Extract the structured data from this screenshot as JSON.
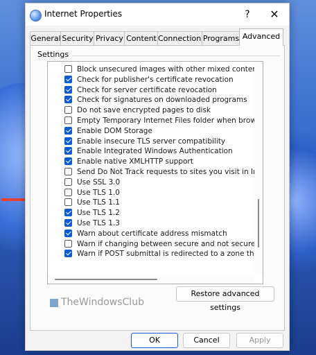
{
  "window": {
    "title": "Internet Properties",
    "help_glyph": "?",
    "close_glyph": "✕"
  },
  "tabs": [
    {
      "label": "General"
    },
    {
      "label": "Security"
    },
    {
      "label": "Privacy"
    },
    {
      "label": "Content"
    },
    {
      "label": "Connections"
    },
    {
      "label": "Programs"
    },
    {
      "label": "Advanced"
    }
  ],
  "settings": {
    "group_label": "Settings",
    "items": [
      {
        "label": "Block unsecured images with other mixed content",
        "checked": false
      },
      {
        "label": "Check for publisher's certificate revocation",
        "checked": true
      },
      {
        "label": "Check for server certificate revocation",
        "checked": true
      },
      {
        "label": "Check for signatures on downloaded programs",
        "checked": true
      },
      {
        "label": "Do not save encrypted pages to disk",
        "checked": false
      },
      {
        "label": "Empty Temporary Internet Files folder when browser is clo",
        "checked": false
      },
      {
        "label": "Enable DOM Storage",
        "checked": true
      },
      {
        "label": "Enable insecure TLS server compatibility",
        "checked": true
      },
      {
        "label": "Enable Integrated Windows Authentication",
        "checked": true
      },
      {
        "label": "Enable native XMLHTTP support",
        "checked": true
      },
      {
        "label": "Send Do Not Track requests to sites you visit in Internet E",
        "checked": false
      },
      {
        "label": "Use SSL 3.0",
        "checked": false
      },
      {
        "label": "Use TLS 1.0",
        "checked": false
      },
      {
        "label": "Use TLS 1.1",
        "checked": false
      },
      {
        "label": "Use TLS 1.2",
        "checked": true
      },
      {
        "label": "Use TLS 1.3",
        "checked": true
      },
      {
        "label": "Warn about certificate address mismatch",
        "checked": true
      },
      {
        "label": "Warn if changing between secure and not secure mode",
        "checked": false
      },
      {
        "label": "Warn if POST submittal is redirected to a zone that does n",
        "checked": true
      }
    ]
  },
  "buttons": {
    "restore": "Restore advanced settings",
    "ok": "OK",
    "cancel": "Cancel",
    "apply": "Apply"
  },
  "watermark": "TheWindowsClub",
  "colors": {
    "accent": "#0f5bd3",
    "arrow": "#e8403a"
  }
}
